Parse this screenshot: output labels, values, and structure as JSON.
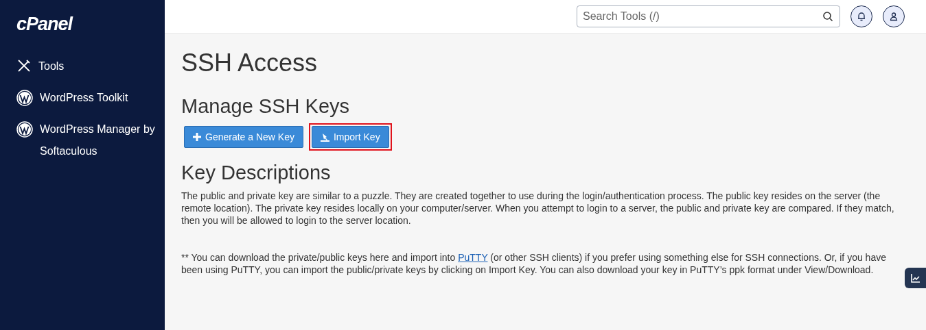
{
  "sidebar": {
    "logo": "cPanel",
    "items": [
      {
        "kind": "tools",
        "label": "Tools"
      },
      {
        "kind": "wordpress",
        "label": "WordPress Toolkit"
      },
      {
        "kind": "wordpress",
        "label": "WordPress Manager by Softaculous"
      }
    ]
  },
  "header": {
    "search": {
      "placeholder": "Search Tools (/)"
    }
  },
  "page_title": "SSH Access",
  "manage": {
    "heading": "Manage SSH Keys",
    "buttons": [
      {
        "kind": "plus",
        "label": "Generate a New Key",
        "highlighted": false
      },
      {
        "kind": "import",
        "label": "Import Key",
        "highlighted": true
      }
    ]
  },
  "descriptions": {
    "heading": "Key Descriptions",
    "paragraph": "The public and private key are similar to a puzzle. They are created together to use during the login/authentication process. The public key resides on the server (the remote location). The private key resides locally on your computer/server. When you attempt to login to a server, the public and private key are compared. If they match, then you will be allowed to login to the server location.",
    "note_before": "** You can download the private/public keys here and import into",
    "note_link": "PuTTY",
    "note_after": "(or other SSH clients) if you prefer using something else for SSH connections. Or, if you have been using PuTTY, you can import the public/private keys by clicking on Import Key. You can also download your key in PuTTY’s ppk format under View/Download."
  }
}
